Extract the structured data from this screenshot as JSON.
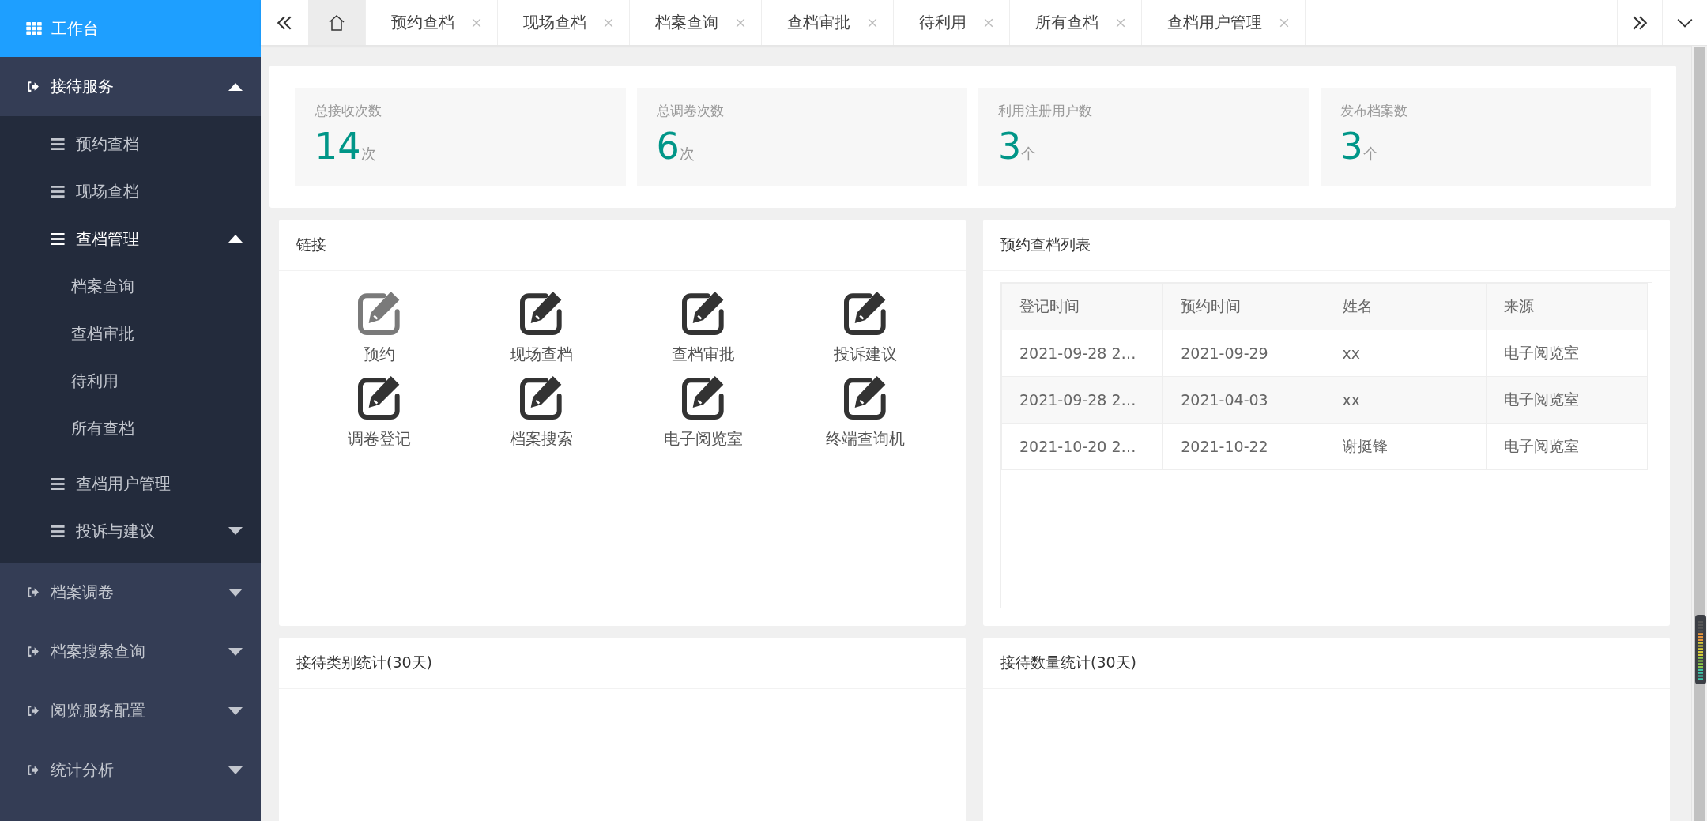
{
  "sidebar": {
    "logo": {
      "label": "工作台"
    },
    "items": [
      {
        "label": "接待服务",
        "expanded": true,
        "children": [
          {
            "label": "预约查档"
          },
          {
            "label": "现场查档"
          },
          {
            "label": "查档管理",
            "expanded": true,
            "children": [
              {
                "label": "档案查询"
              },
              {
                "label": "查档审批"
              },
              {
                "label": "待利用"
              },
              {
                "label": "所有查档"
              }
            ]
          },
          {
            "label": "查档用户管理"
          },
          {
            "label": "投诉与建议",
            "expanded": false
          }
        ]
      },
      {
        "label": "档案调卷",
        "expanded": false
      },
      {
        "label": "档案搜索查询",
        "expanded": false
      },
      {
        "label": "阅览服务配置",
        "expanded": false
      },
      {
        "label": "统计分析",
        "expanded": false
      }
    ]
  },
  "tabs": [
    {
      "kind": "home",
      "selected": true
    },
    {
      "kind": "page",
      "label": "预约查档",
      "selected": false
    },
    {
      "kind": "page",
      "label": "现场查档",
      "selected": false
    },
    {
      "kind": "page",
      "label": "档案查询",
      "selected": false
    },
    {
      "kind": "page",
      "label": "查档审批",
      "selected": false
    },
    {
      "kind": "page",
      "label": "待利用",
      "selected": false
    },
    {
      "kind": "page",
      "label": "所有查档",
      "selected": false
    },
    {
      "kind": "page",
      "label": "查档用户管理",
      "selected": false
    }
  ],
  "stats": [
    {
      "label": "总接收次数",
      "value": "14",
      "unit": "次"
    },
    {
      "label": "总调卷次数",
      "value": "6",
      "unit": "次"
    },
    {
      "label": "利用注册用户数",
      "value": "3",
      "unit": "个"
    },
    {
      "label": "发布档案数",
      "value": "3",
      "unit": "个"
    }
  ],
  "links_panel": {
    "title": "链接",
    "links": [
      {
        "label": "预约",
        "hover": true
      },
      {
        "label": "现场查档",
        "hover": false
      },
      {
        "label": "查档审批",
        "hover": false
      },
      {
        "label": "投诉建议",
        "hover": false
      },
      {
        "label": "调卷登记",
        "hover": false
      },
      {
        "label": "档案搜索",
        "hover": false
      },
      {
        "label": "电子阅览室",
        "hover": false
      },
      {
        "label": "终端查询机",
        "hover": false
      }
    ]
  },
  "appointments_panel": {
    "title": "预约查档列表",
    "table": {
      "columns": [
        "登记时间",
        "预约时间",
        "姓名",
        "来源"
      ],
      "rows": [
        [
          "2021-09-28 2…",
          "2021-09-29",
          "xx",
          "电子阅览室"
        ],
        [
          "2021-09-28 2…",
          "2021-04-03",
          "xx",
          "电子阅览室"
        ],
        [
          "2021-10-20 2…",
          "2021-10-22",
          "谢挺锋",
          "电子阅览室"
        ]
      ]
    }
  },
  "chart_panels": [
    {
      "title": "接待类别统计(30天)"
    },
    {
      "title": "接待数量统计(30天)"
    }
  ]
}
